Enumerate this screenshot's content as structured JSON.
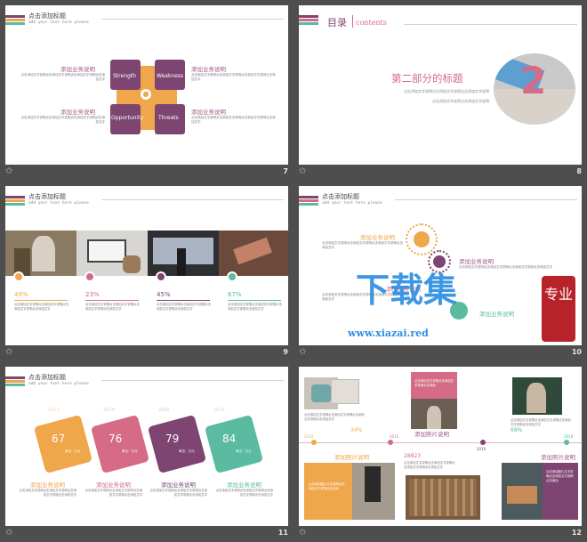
{
  "header": {
    "title": "点击添加标题",
    "subtitle": "add your text here please"
  },
  "desc_text": "点击添加文字说明点击添加文字说明点击添加文字说明点击添加文字",
  "slide7": {
    "number": "7",
    "swot": [
      "Strength",
      "Weakness",
      "Opportunity",
      "Threats"
    ],
    "items": [
      {
        "title": "添加业务说明"
      },
      {
        "title": "添加业务说明"
      },
      {
        "title": "添加业务说明"
      },
      {
        "title": "添加业务说明"
      }
    ]
  },
  "slide8": {
    "number": "8",
    "toc": "目录",
    "toc_en": "contents",
    "part_title": "第二部分的标题",
    "part_desc1": "点击添加文字说明点击添加文字说明点击添加文字说明",
    "part_desc2": "点击添加文字说明点击添加文字说明",
    "big_number": "2"
  },
  "slide9": {
    "number": "9",
    "stats": [
      {
        "pct": "49%",
        "color": "#f0a64a"
      },
      {
        "pct": "23%",
        "color": "#d56b86"
      },
      {
        "pct": "45%",
        "color": "#7e4572"
      },
      {
        "pct": "67%",
        "color": "#5abba0"
      }
    ]
  },
  "slide10": {
    "number": "10",
    "items": [
      "添加业务说明",
      "添加业务说明",
      "添加业务说明",
      "添加业务说明"
    ],
    "watermark_main": "下载集",
    "watermark_url": "www.xiazai.red",
    "watermark_stamp": "专业"
  },
  "slide11": {
    "number": "11",
    "years": [
      "2013",
      "2014",
      "2015",
      "2016"
    ],
    "values": [
      "67",
      "76",
      "79",
      "84"
    ],
    "unit": "单位：万元",
    "colors": [
      "#f0a64a",
      "#d56b86",
      "#7e4572",
      "#5abba0"
    ],
    "titles": [
      "添加业务说明",
      "添加业务说明",
      "添加业务说明",
      "添加业务说明"
    ]
  },
  "slide12": {
    "number": "12",
    "years": [
      "2014",
      "2015",
      "2016",
      "2018"
    ],
    "values": [
      "34%",
      "28823",
      "68%"
    ],
    "photo_label": "添加照片说明",
    "pink_text": "点击添加文字说明点击添加文字说明点击添加",
    "box_text": "点击添加图片文字说明点击添加文字说明点击添加"
  }
}
